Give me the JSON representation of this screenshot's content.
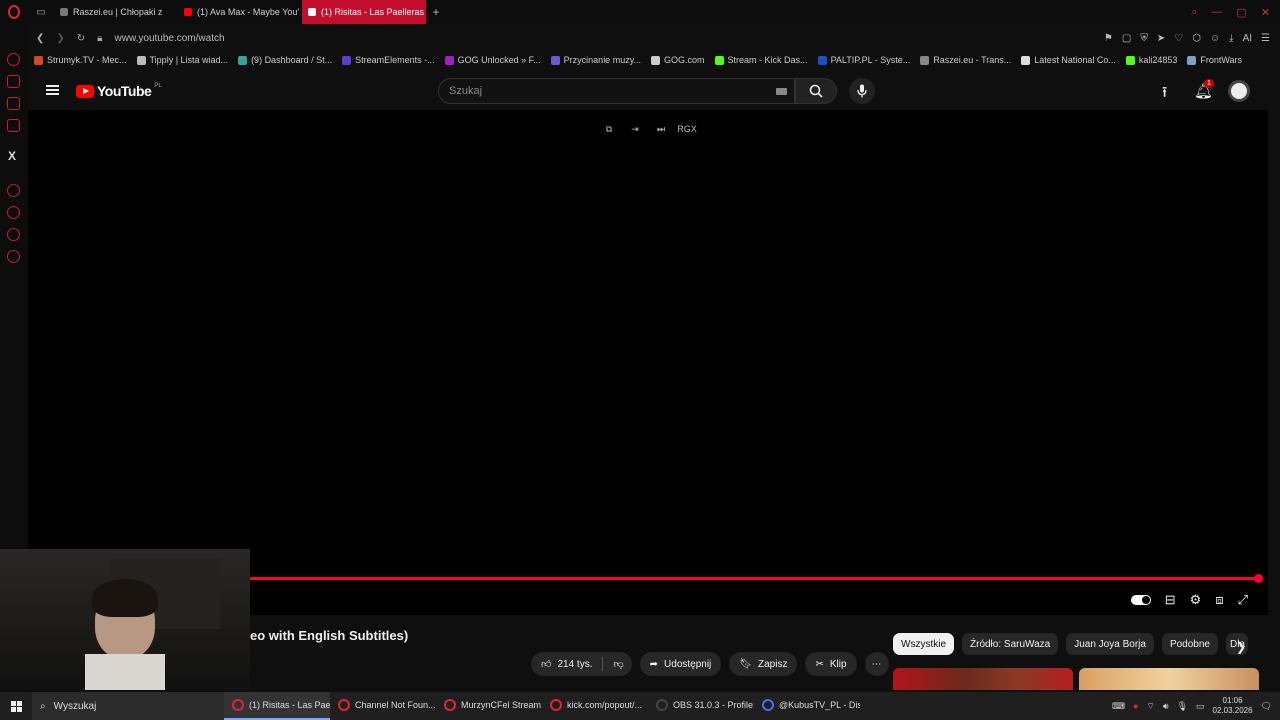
{
  "browser": {
    "tabs": [
      {
        "label": "Raszei.eu | Chłopaki z",
        "fav": "#777777"
      },
      {
        "label": "(1) Ava Max - Maybe You'",
        "fav": "#ff0000"
      },
      {
        "label": "(1) Risitas - Las Paelleras (",
        "fav": "#ff0000"
      }
    ],
    "url": "www.youtube.com/watch",
    "bookmarks": [
      {
        "label": "Strumyk.TV - Mec...",
        "color": "#d04a2a"
      },
      {
        "label": "Tipply | Lista wiad...",
        "color": "#bbbbbb"
      },
      {
        "label": "(9) Dashboard / St...",
        "color": "#3aa0a0"
      },
      {
        "label": "StreamElements -...",
        "color": "#5a3fd0"
      },
      {
        "label": "GOG Unlocked » F...",
        "color": "#a020c0"
      },
      {
        "label": "Przycinanie muzy...",
        "color": "#6a5acd"
      },
      {
        "label": "GOG.com",
        "color": "#cccccc"
      },
      {
        "label": "Stream - Kick Das...",
        "color": "#53fc18"
      },
      {
        "label": "PALTIP.PL - Syste...",
        "color": "#2050c0"
      },
      {
        "label": "Raszei.eu - Trans...",
        "color": "#888888"
      },
      {
        "label": "Latest National Co...",
        "color": "#dddddd"
      },
      {
        "label": "kali24853",
        "color": "#53fc18"
      },
      {
        "label": "FrontWars",
        "color": "#7fa0c0"
      }
    ]
  },
  "youtube": {
    "logo_text": "YouTube",
    "region": "PL",
    "search_placeholder": "Szukaj",
    "notifications_count": "1",
    "player_tools": [
      "⧉",
      "⇥",
      "⏭",
      "RGX"
    ],
    "video_title": "eo with English Subtitles)",
    "actions": {
      "likes": "214 tys.",
      "share": "Udostępnij",
      "save": "Zapisz",
      "clip": "Klip",
      "more": "⋯"
    },
    "chips": [
      "Wszystkie",
      "Źródło: SaruWaza",
      "Juan Joya Borja",
      "Podobne",
      "Dla"
    ],
    "progress": 1.0
  },
  "taskbar": {
    "search_placeholder": "Wyszukaj",
    "apps": [
      {
        "label": "(1) Risitas - Las Pael...",
        "active": true
      },
      {
        "label": "Channel Not Foun...",
        "active": false
      },
      {
        "label": "MurzynCFel Stream...",
        "active": false
      },
      {
        "label": "kick.com/popout/...",
        "active": false
      },
      {
        "label": "OBS 31.0.3 - Profile:...",
        "active": false
      },
      {
        "label": "@KubusTV_PL - Dis...",
        "active": false
      }
    ],
    "time": "01:06",
    "date": "02.03.2026"
  }
}
